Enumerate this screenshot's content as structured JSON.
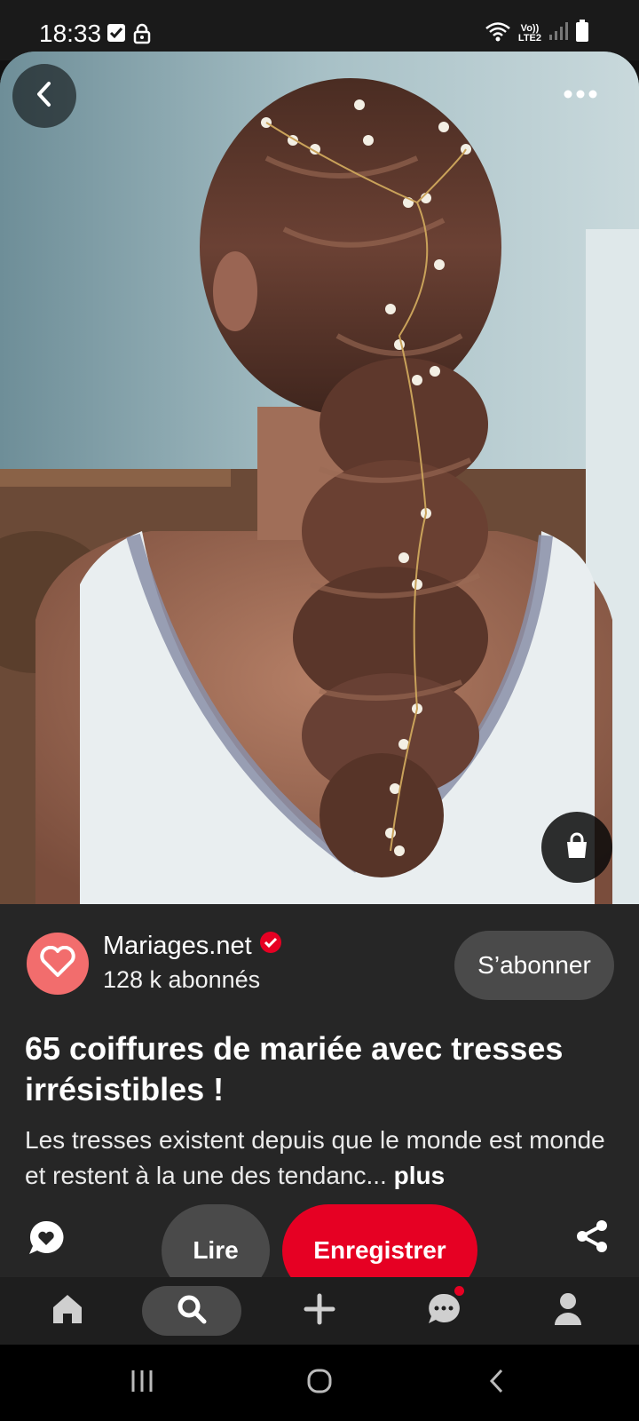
{
  "status_bar": {
    "time": "18:33",
    "network_line1": "Vo))",
    "network_line2": "LTE2",
    "icons": [
      "check-box-icon",
      "lock-icon",
      "wifi-icon",
      "signal-icon",
      "battery-icon"
    ]
  },
  "hero": {
    "back_icon": "chevron-left-icon",
    "more_icon": "more-horizontal-icon",
    "shop_icon": "shopping-bag-icon"
  },
  "publisher": {
    "name": "Mariages.net",
    "followers": "128 k abonnés",
    "verified_icon": "verified-badge-icon",
    "follow_label": "S’abonner"
  },
  "pin": {
    "title": "65 coiffures de mariée avec tresses irrésistibles !",
    "description": "Les tresses existent depuis que le monde est monde et restent à la une des tendanc...",
    "more_label": "plus"
  },
  "actions": {
    "read_label": "Lire",
    "save_label": "Enregistrer",
    "comment_icon": "comment-icon",
    "share_icon": "share-icon"
  },
  "bottom_nav": {
    "items": [
      "home-icon",
      "search-icon",
      "plus-icon",
      "messages-icon",
      "profile-icon"
    ],
    "active": "search-icon"
  },
  "colors": {
    "brand_red": "#e60023",
    "panel_bg": "#262626",
    "button_gray": "#4a4a4a",
    "avatar_pink": "#f26d6d"
  }
}
